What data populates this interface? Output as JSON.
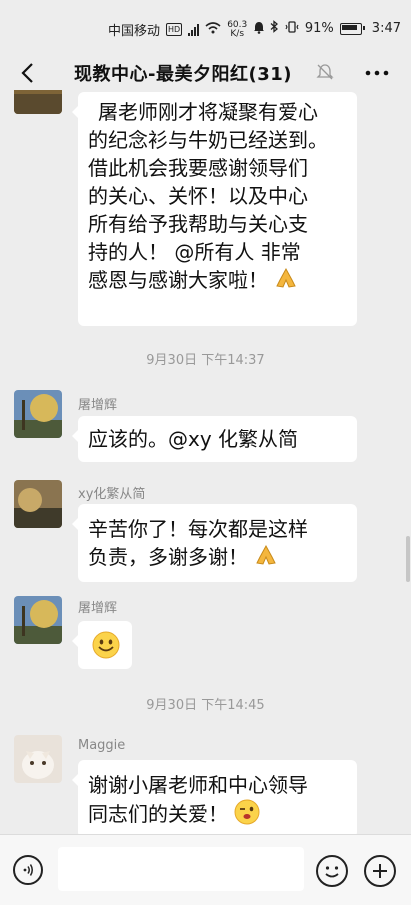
{
  "status": {
    "carrier": "中国移动",
    "hd": "HD",
    "net_speed": "60.3",
    "net_unit": "K/s",
    "battery": "91%",
    "time": "3:47"
  },
  "nav": {
    "title": "现教中心-最美夕阳红(31)"
  },
  "messages": [
    {
      "type": "text",
      "lines": [
        "屠老师刚才将凝聚有爱心",
        "的纪念衫与牛奶已经送到。",
        "借此机会我要感谢领导们",
        "的关心、关怀！以及中心",
        "所有给予我帮助与关心支",
        "持的人！ @所有人  非常",
        "感恩与感谢大家啦！"
      ]
    },
    {
      "type": "time",
      "text": "9月30日 下午14:37"
    },
    {
      "type": "text",
      "sender": "屠增辉",
      "lines": [
        "应该的。@xy 化繁从简"
      ]
    },
    {
      "type": "text",
      "sender": "xy化繁从简",
      "lines": [
        "辛苦你了！每次都是这样",
        "负责，多谢多谢！"
      ]
    },
    {
      "type": "emoji",
      "sender": "屠增辉",
      "emoji": "smile"
    },
    {
      "type": "time",
      "text": "9月30日 下午14:45"
    },
    {
      "type": "text",
      "sender": "Maggie",
      "lines": [
        "谢谢小屠老师和中心领导",
        "同志们的关爱！"
      ]
    }
  ],
  "input": {
    "placeholder": ""
  },
  "colors": {
    "background": "#ededed",
    "bubble": "#ffffff",
    "meta_text": "#999999"
  }
}
